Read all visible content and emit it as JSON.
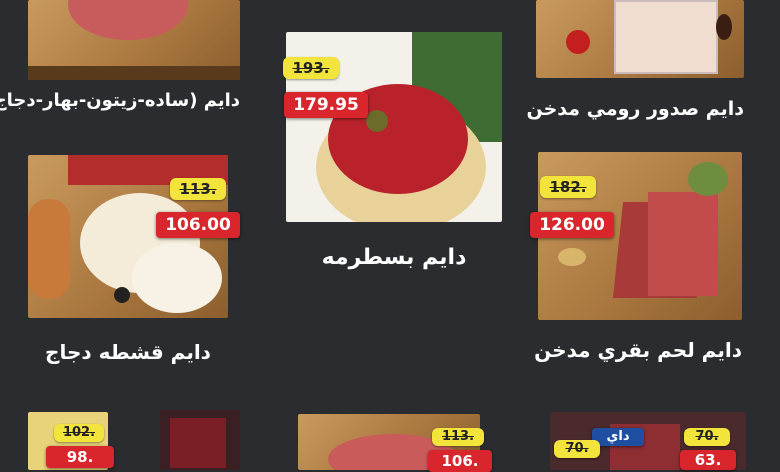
{
  "products": [
    {
      "name": "دايم (ساده-زيتون-بهار-دجاج)"
    },
    {
      "name": "دايم بسطرمه",
      "old_price": "193.",
      "new_price": "179.95"
    },
    {
      "name": "دايم صدور رومي مدخن"
    },
    {
      "name": "دايم قشطه دجاج",
      "old_price": "113.",
      "new_price": "106.00"
    },
    {
      "name": "دايم لحم بقري مدخن",
      "old_price": "182.",
      "new_price": "126.00"
    }
  ],
  "bottom_row": [
    {
      "old_price": "102.",
      "new_price": "98."
    },
    {
      "old_price": "113.",
      "new_price": "106."
    },
    {
      "old_price": "70.",
      "new_price": "70.",
      "tag": "داي"
    },
    {
      "old_price": "70.",
      "new_price": "63."
    }
  ],
  "colors": {
    "background": "#2b2c2f",
    "old_price_bg": "#f3e43b",
    "new_price_bg": "#d8262c"
  }
}
